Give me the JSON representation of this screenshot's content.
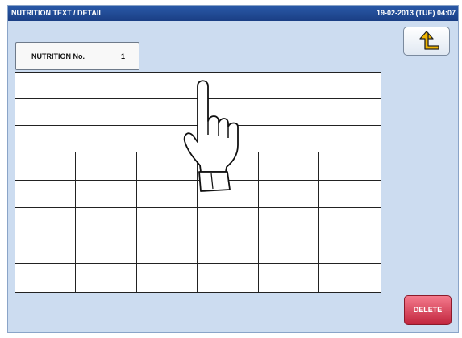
{
  "header": {
    "title": "NUTRITION TEXT / DETAIL",
    "datetime": "19-02-2013 (TUE) 04:07"
  },
  "nutrition_no": {
    "label": "NUTRITION No.",
    "value": "1"
  },
  "back_button": {
    "icon": "return-arrow-icon"
  },
  "delete_button": {
    "label": "DELETE"
  },
  "table": {
    "full_width_rows": [
      "",
      "",
      ""
    ],
    "grid_rows": [
      [
        "",
        "",
        "",
        "",
        "",
        ""
      ],
      [
        "",
        "",
        "",
        "",
        "",
        ""
      ],
      [
        "",
        "",
        "",
        "",
        "",
        ""
      ],
      [
        "",
        "",
        "",
        "",
        "",
        ""
      ],
      [
        "",
        "",
        "",
        "",
        "",
        ""
      ]
    ]
  },
  "overlay": {
    "icon": "pointing-hand-icon"
  },
  "colors": {
    "titlebar": "#1f4c9a",
    "screen_bg": "#ccdcf0",
    "delete": "#d9304a",
    "back_arrow": "#f0b400"
  }
}
